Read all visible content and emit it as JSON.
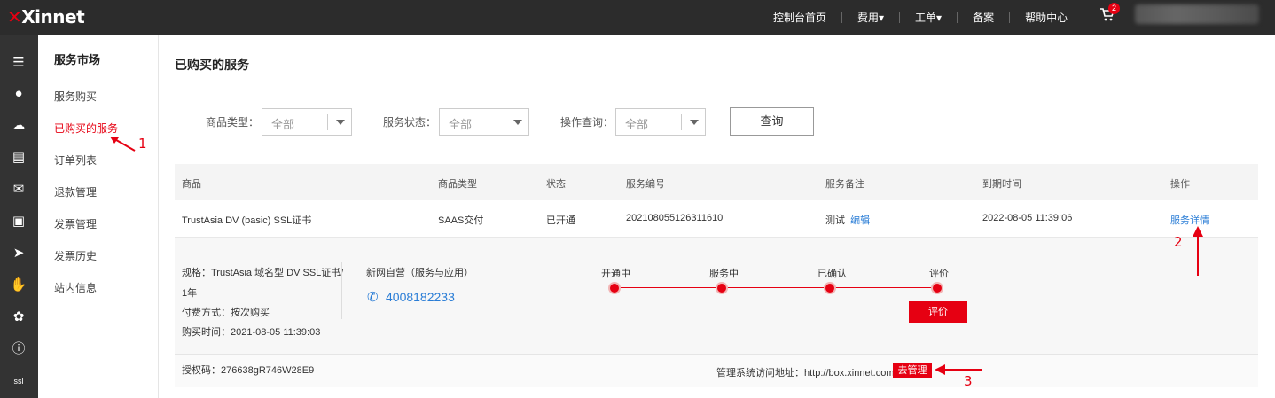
{
  "header": {
    "logo": "Xinnet",
    "nav": [
      "控制台首页",
      "费用▾",
      "工单▾",
      "备案",
      "帮助中心"
    ],
    "cart_count": "2"
  },
  "rail_icons": [
    "menu-icon",
    "globe-icon",
    "cloud-icon",
    "server-icon",
    "mail-icon",
    "chart-icon",
    "send-icon",
    "hand-icon",
    "cluster-icon",
    "info-icon",
    "ssl-icon"
  ],
  "sidebar": {
    "title": "服务市场",
    "items": [
      "服务购买",
      "已购买的服务",
      "订单列表",
      "退款管理",
      "发票管理",
      "发票历史",
      "站内信息"
    ]
  },
  "main": {
    "title": "已购买的服务",
    "filters": [
      {
        "label": "商品类型：",
        "value": "全部"
      },
      {
        "label": "服务状态：",
        "value": "全部"
      },
      {
        "label": "操作查询：",
        "value": "全部"
      }
    ],
    "query_button": "查询",
    "table": {
      "headers": [
        "商品",
        "商品类型",
        "状态",
        "服务编号",
        "服务备注",
        "到期时间",
        "操作"
      ],
      "row": {
        "product": "TrustAsia DV (basic) SSL证书",
        "type": "SAAS交付",
        "status": "已开通",
        "service_no": "202108055126311610",
        "remark": "测试",
        "edit": "编辑",
        "expire": "2022-08-05 11:39:06",
        "action": "服务详情"
      }
    },
    "detail": {
      "spec_line1": "规格：TrustAsia 域名型 DV SSL证书/",
      "spec_line2": "1年",
      "pay": "付费方式：按次购买",
      "buy_time": "购买时间：2021-08-05 11:39:03",
      "vendor": "新网自营（服务与应用）",
      "phone": "4008182233",
      "steps": [
        "开通中",
        "服务中",
        "已确认",
        "评价"
      ],
      "rate_button": "评价",
      "auth_code": "授权码：276638gR746W28E9",
      "manage_url": "管理系统访问地址：http://box.xinnet.com",
      "manage_button": "去管理"
    }
  },
  "annotations": [
    "1",
    "2",
    "3"
  ],
  "colors": {
    "accent": "#e60012",
    "link": "#2a7dd6",
    "topbar": "#2c2c2c",
    "rail": "#333333"
  }
}
